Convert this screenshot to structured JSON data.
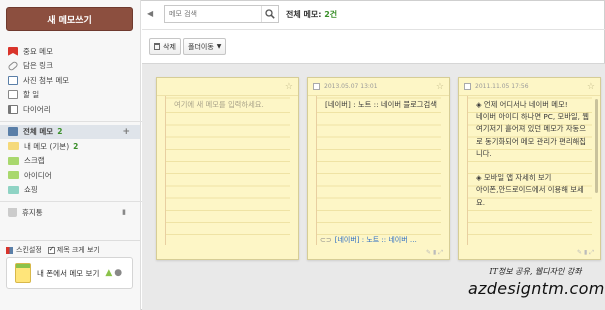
{
  "sidebar": {
    "new_memo_label": "새 메모쓰기",
    "nav": [
      {
        "label": "중요 메모",
        "icon": "important-icon",
        "color": "#d9342b"
      },
      {
        "label": "담은 링크",
        "icon": "link-icon",
        "color": "#888888"
      },
      {
        "label": "사진 첨부 메모",
        "icon": "photo-icon",
        "color": "#5a7fa8"
      },
      {
        "label": "할 일",
        "icon": "todo-icon",
        "color": "#777777"
      },
      {
        "label": "다이어리",
        "icon": "diary-icon",
        "color": "#7a7a7a"
      }
    ],
    "all_memo": {
      "label": "전체 메모",
      "count": "2",
      "add_icon": "plus-icon"
    },
    "folders": [
      {
        "label": "내 메모 (기본)",
        "count": "2",
        "color": "#f5d97a"
      },
      {
        "label": "스크랩",
        "count": "",
        "color": "#a9d86e"
      },
      {
        "label": "아이디어",
        "count": "",
        "color": "#a9d86e"
      },
      {
        "label": "쇼핑",
        "count": "",
        "color": "#8fd3c4"
      }
    ],
    "trash_label": "휴지통",
    "skin_label": "스킨설정",
    "title_large_label": "제목 크게 보기",
    "phone_label": "내 폰에서 메모 보기"
  },
  "header": {
    "search_placeholder": "메모 검색",
    "total_label": "전체 메모:",
    "total_count": "2건"
  },
  "toolbar": {
    "delete_label": "삭제",
    "move_label": "폴더이동"
  },
  "cards": [
    {
      "date": "",
      "placeholder": "여기에 새 메모를 입력하세요.",
      "content": "",
      "link": ""
    },
    {
      "date": "2013.05.07 13:01",
      "content": "[네이버] : 노트 :: 네이버 블로그검색",
      "link": "[네이버] : 노트 :: 네이버 …"
    },
    {
      "date": "2011.11.05 17:56",
      "content_lines": [
        "◈ 언제 어디서나 네이버 메모!",
        "네이버 아이디 하나면 PC, 모바일, 웹 여기저기 흩어져 있던 메모가 자동으로 동기화되어 메모 관리가 편리해집니다.",
        "",
        "◈ 모바일 앱 자세히 보기",
        "아이폰,안드로이드에서 이용해 보세요."
      ]
    }
  ],
  "watermark": {
    "line1": "IT정보 공유, 웹디자인 강좌",
    "line2": "azdesigntm.com"
  }
}
